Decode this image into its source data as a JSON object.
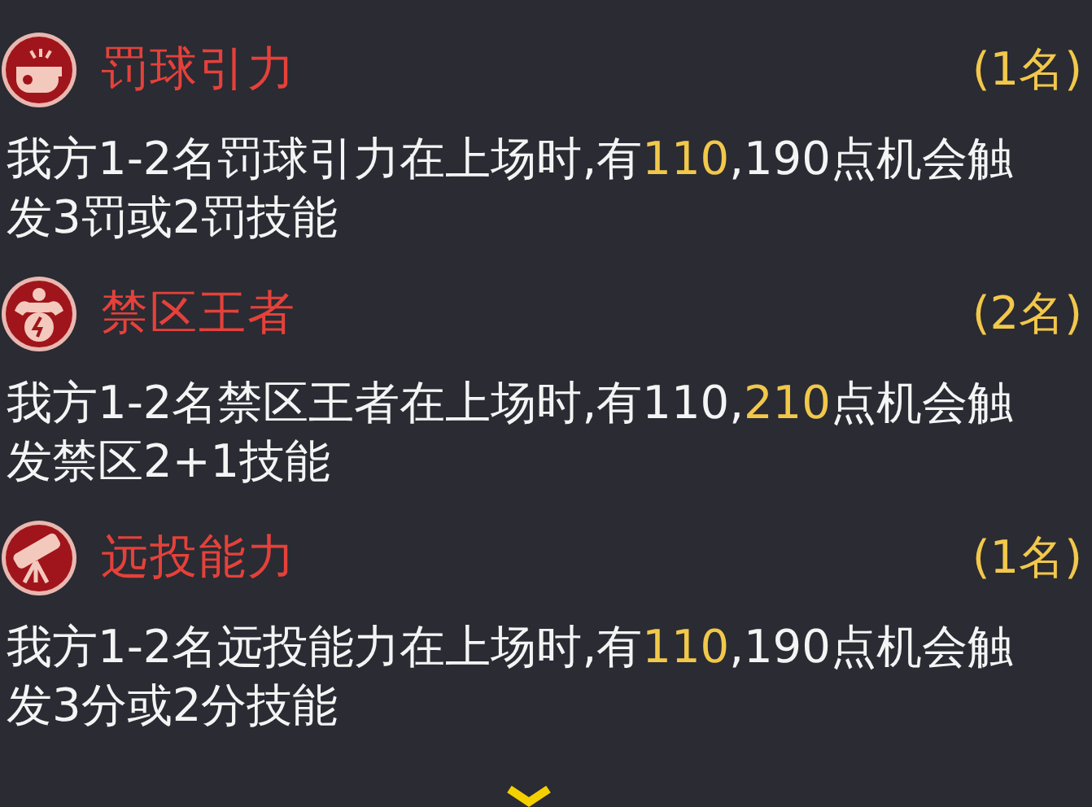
{
  "skills": [
    {
      "title": "罚球引力",
      "count": "(1名)",
      "description": [
        {
          "text": "我方1-2名罚球引力在上场时,有",
          "highlight": false
        },
        {
          "text": "110",
          "highlight": true
        },
        {
          "text": ",190点机会触发3罚或2罚技能",
          "highlight": false
        }
      ]
    },
    {
      "title": "禁区王者",
      "count": "(2名)",
      "description": [
        {
          "text": "我方1-2名禁区王者在上场时,有110,",
          "highlight": false
        },
        {
          "text": "210",
          "highlight": true
        },
        {
          "text": "点机会触发禁区2+1技能",
          "highlight": false
        }
      ]
    },
    {
      "title": "远投能力",
      "count": "(1名)",
      "description": [
        {
          "text": "我方1-2名远投能力在上场时,有",
          "highlight": false
        },
        {
          "text": "110",
          "highlight": true
        },
        {
          "text": ",190点机会触发3分或2分技能",
          "highlight": false
        }
      ]
    }
  ]
}
